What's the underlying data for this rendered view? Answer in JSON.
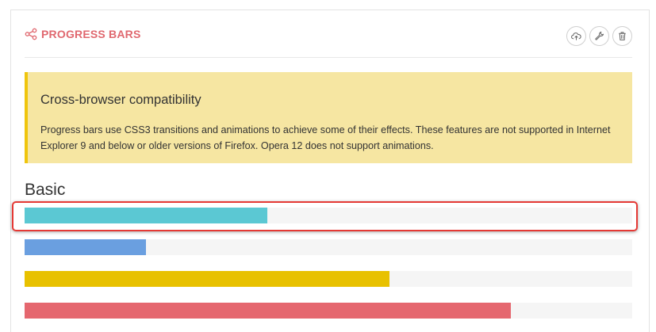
{
  "panel": {
    "title": "PROGRESS BARS",
    "title_color": "#e0686f",
    "title_icon": "share-icon",
    "tools": [
      {
        "name": "cloud-upload-icon"
      },
      {
        "name": "wrench-icon"
      },
      {
        "name": "trash-icon"
      }
    ]
  },
  "alert": {
    "title": "Cross-browser compatibility",
    "body": "Progress bars use CSS3 transitions and animations to achieve some of their effects. These features are not supported in Internet Explorer 9 and below or older versions of Firefox. Opera 12 does not support animations.",
    "background": "#f6e6a2",
    "accent": "#efc50d"
  },
  "section": {
    "title": "Basic"
  },
  "progress_bars": [
    {
      "value": 40,
      "color": "#5bc8d3",
      "highlighted": true
    },
    {
      "value": 20,
      "color": "#6a9fe0",
      "highlighted": false
    },
    {
      "value": 60,
      "color": "#e8c100",
      "highlighted": false
    },
    {
      "value": 80,
      "color": "#e5676f",
      "highlighted": false
    }
  ]
}
